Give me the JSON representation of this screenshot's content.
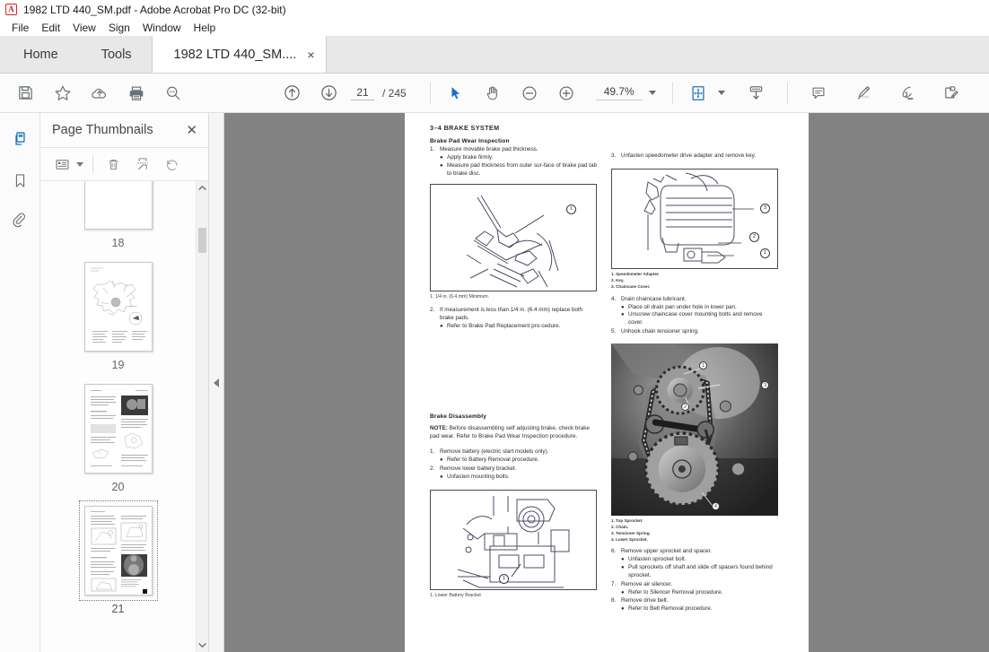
{
  "window": {
    "title": "1982 LTD 440_SM.pdf - Adobe Acrobat Pro DC (32-bit)",
    "app_icon": "acrobat-logo-icon",
    "logo_glyph": "A"
  },
  "menubar": {
    "items": [
      {
        "label": "File"
      },
      {
        "label": "Edit"
      },
      {
        "label": "View"
      },
      {
        "label": "Sign"
      },
      {
        "label": "Window"
      },
      {
        "label": "Help"
      }
    ]
  },
  "tabs": {
    "home": "Home",
    "tools": "Tools",
    "document": "1982 LTD 440_SM....",
    "close_glyph": "×"
  },
  "toolbar": {
    "save_label": "save-icon",
    "star_label": "add-to-favorites-icon",
    "cloud_label": "upload-to-cloud-icon",
    "print_label": "print-icon",
    "find_label": "find-text-icon",
    "prev_page_label": "previous-page-icon",
    "next_page_label": "next-page-icon",
    "page_number": "21",
    "page_total": "/ 245",
    "select_tool_label": "select-cursor-icon",
    "hand_tool_label": "hand-tool-icon",
    "zoom_out_label": "zoom-out-icon",
    "zoom_in_label": "zoom-in-icon",
    "zoom_value": "49.7%",
    "fit_page_label": "page-fit-icon",
    "download_label": "download-icon",
    "comment_label": "add-comment-icon",
    "highlight_label": "highlight-text-icon",
    "sign_label": "sign-document-icon",
    "fill_sign_label": "fill-and-sign-icon",
    "accent_color": "#1a6fc4"
  },
  "rail": {
    "items": [
      {
        "name": "page-thumbnails",
        "icon": "page-thumbnails-icon",
        "active": true
      },
      {
        "name": "bookmarks",
        "icon": "bookmark-icon",
        "active": false
      },
      {
        "name": "attachments",
        "icon": "paperclip-icon",
        "active": false
      }
    ]
  },
  "thumbnails_panel": {
    "title": "Page Thumbnails",
    "close_glyph": "✕",
    "options_label": "thumbnail-options-icon",
    "delete_label": "delete-pages-icon",
    "extract_label": "extract-pages-icon",
    "rotate_label": "rotate-pages-icon",
    "pages": [
      {
        "label": "18",
        "selected": false,
        "kind": "blank"
      },
      {
        "label": "19",
        "selected": false,
        "kind": "diagram"
      },
      {
        "label": "20",
        "selected": false,
        "kind": "mixed"
      },
      {
        "label": "21",
        "selected": true,
        "kind": "mixed2"
      }
    ],
    "scroll_up_glyph": "⌃",
    "scroll_down_glyph": "⌄"
  },
  "collapse_handle": {
    "label": "collapse-sidebar-handle"
  },
  "document_page": {
    "running_head": "3–4   BRAKE SYSTEM",
    "left_column": {
      "section1_heading": "Brake Pad Wear Inspection",
      "section1_items": [
        {
          "n": "1.",
          "text": "Measure movable brake pad thickness."
        },
        {
          "b": "●",
          "text": "Apply brake firmly."
        },
        {
          "b": "●",
          "text": "Measure pad thickness from outer sur-face of brake pad tab to brake disc."
        }
      ],
      "fig1_caption": "1. 1/4 in. (6.4 mm) Minimum.",
      "fig1_callouts": [
        "1"
      ],
      "section1_items_after": [
        {
          "n": "2.",
          "text": "If measurement is less than 1/4 in. (6.4 mm) replace both brake pads."
        },
        {
          "b": "●",
          "text": "Refer to Brake Pad Replacement pro-cedure."
        }
      ],
      "section2_heading": "Brake Disassembly",
      "section2_note": "NOTE:",
      "section2_note_text": " Before disassembling self adjusting brake, check brake pad wear. Refer to Brake Pad Wear Inspection procedure.",
      "section2_items": [
        {
          "n": "1.",
          "text": "Remove battery (electric start models only)."
        },
        {
          "b": "●",
          "text": "Refer to Battery Removal procedure."
        },
        {
          "n": "2.",
          "text": "Remove lower battery bracket."
        },
        {
          "b": "●",
          "text": "Unfasten mounting bolts."
        }
      ],
      "fig2_caption": "1. Lower Battery Bracket",
      "fig2_callouts": [
        "1"
      ]
    },
    "right_column": {
      "item3": {
        "n": "3.",
        "text": "Unfasten speedometer drive adapter and remove key."
      },
      "fig3_callouts": [
        "3",
        "2",
        "1"
      ],
      "fig3_legend": [
        "1. Speedometer Adapter.",
        "2. Key.",
        "3. Chaincase Cover."
      ],
      "items_after_fig3": [
        {
          "n": "4.",
          "text": "Drain chaincase lubricant."
        },
        {
          "b": "●",
          "text": "Place oil drain pan under hole in lower pan."
        },
        {
          "b": "●",
          "text": "Unscrew chaincase cover mounting bolts and remove cover."
        },
        {
          "n": "5.",
          "text": "Unhook chain tensioner spring."
        }
      ],
      "fig4_callouts": [
        "1",
        "3",
        "2",
        "4"
      ],
      "fig4_legend": [
        "1. Top Sprocket.",
        "2. Chain.",
        "3. Tensioner Spring.",
        "4. Lower Sprocket."
      ],
      "items_after_fig4": [
        {
          "n": "6.",
          "text": "Remove upper sprocket and spacer."
        },
        {
          "b": "●",
          "text": "Unfasten sprocket bolt."
        },
        {
          "b": "●",
          "text": "Pull sprockets off shaft and slide off spacers found behind sprocket."
        },
        {
          "n": "7.",
          "text": "Remove air silencer."
        },
        {
          "b": "●",
          "text": "Refer to Silencer Removal procedure."
        },
        {
          "n": "8.",
          "text": "Remove drive belt."
        },
        {
          "b": "●",
          "text": "Refer to Belt Removal procedure."
        }
      ]
    }
  }
}
